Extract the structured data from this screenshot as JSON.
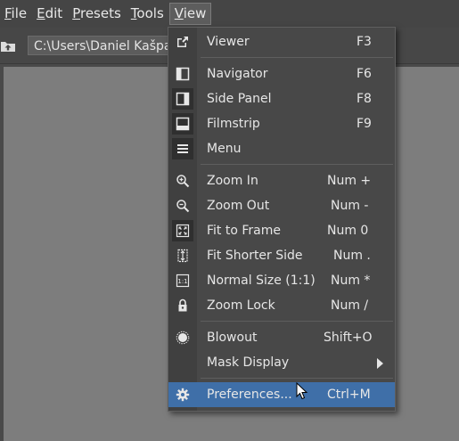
{
  "menubar": {
    "items": [
      {
        "label": "File",
        "accel": "F"
      },
      {
        "label": "Edit",
        "accel": "E"
      },
      {
        "label": "Presets",
        "accel": "P"
      },
      {
        "label": "Tools",
        "accel": "T"
      },
      {
        "label": "View",
        "accel": "V"
      }
    ]
  },
  "toolbar": {
    "path": "C:\\Users\\Daniel Kašpar",
    "up_icon": "folder-up-icon"
  },
  "view_menu": {
    "items": [
      {
        "label": "Viewer",
        "shortcut": "F3",
        "icon": "open-external-icon"
      },
      {
        "label": "Navigator",
        "shortcut": "F6",
        "icon": "navigator-panel-icon"
      },
      {
        "label": "Side Panel",
        "shortcut": "F8",
        "icon": "side-panel-icon",
        "checked": true
      },
      {
        "label": "Filmstrip",
        "shortcut": "F9",
        "icon": "filmstrip-icon",
        "checked": true
      },
      {
        "label": "Menu",
        "shortcut": "",
        "icon": "hamburger-menu-icon",
        "checked": true
      },
      {
        "label": "Zoom In",
        "shortcut": "Num +",
        "icon": "zoom-in-icon"
      },
      {
        "label": "Zoom Out",
        "shortcut": "Num -",
        "icon": "zoom-out-icon"
      },
      {
        "label": "Fit to Frame",
        "shortcut": "Num 0",
        "icon": "fit-to-frame-icon",
        "checked": true
      },
      {
        "label": "Fit Shorter Side",
        "shortcut": "Num .",
        "icon": "fit-shorter-side-icon"
      },
      {
        "label": "Normal Size (1:1)",
        "shortcut": "Num *",
        "icon": "one-to-one-icon"
      },
      {
        "label": "Zoom Lock",
        "shortcut": "Num /",
        "icon": "lock-icon"
      },
      {
        "label": "Blowout",
        "shortcut": "Shift+O",
        "icon": "blowout-icon"
      },
      {
        "label": "Mask Display",
        "shortcut": "",
        "icon": "",
        "submenu": true
      },
      {
        "label": "Preferences...",
        "shortcut": "Ctrl+M",
        "icon": "gear-icon",
        "highlighted": true
      }
    ]
  },
  "colors": {
    "highlight": "#3f6fa8",
    "menu_bg": "#484848",
    "content_bg": "#7d7d7d"
  }
}
